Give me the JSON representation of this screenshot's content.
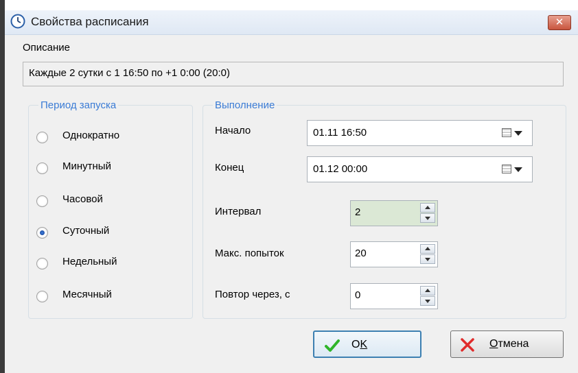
{
  "window": {
    "title": "Свойства расписания",
    "close_label": "✕",
    "close_color": "#c8553e"
  },
  "description": {
    "label": "Описание",
    "value": "Каждые 2 сутки с 1 16:50 по +1 0:00 (20:0)"
  },
  "period_group": {
    "legend": "Период запуска",
    "options": [
      {
        "label": "Однократно",
        "selected": false
      },
      {
        "label": "Минутный",
        "selected": false
      },
      {
        "label": "Часовой",
        "selected": false
      },
      {
        "label": "Суточный",
        "selected": true
      },
      {
        "label": "Недельный",
        "selected": false
      },
      {
        "label": "Месячный",
        "selected": false
      }
    ]
  },
  "execution_group": {
    "legend": "Выполнение",
    "start": {
      "label": "Начало",
      "value": "01.11 16:50"
    },
    "end": {
      "label": "Конец",
      "value": "01.12 00:00"
    },
    "interval": {
      "label": "Интервал",
      "value": "2"
    },
    "max_attempts": {
      "label": "Макс. попыток",
      "value": "20"
    },
    "retry_after": {
      "label": "Повтор через, с",
      "value": "0"
    }
  },
  "buttons": {
    "ok_mnemonic": "O",
    "ok_rest": "K",
    "cancel_mnemonic": "О",
    "cancel_rest": "тмена"
  },
  "colors": {
    "accent": "#3a7bd5",
    "highlight_field": "#dbe8d5",
    "ok_check": "#2fb52a",
    "cancel_x": "#e02b2b"
  }
}
